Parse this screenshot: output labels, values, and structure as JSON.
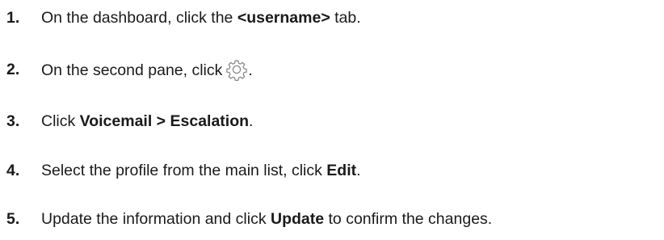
{
  "steps": [
    {
      "number": "1.",
      "before": "On the dashboard, click the ",
      "bold": "<username>",
      "after": " tab."
    },
    {
      "number": "2.",
      "before": "On the second pane, click",
      "icon": "gear-icon",
      "after": "."
    },
    {
      "number": "3.",
      "before": "Click ",
      "bold": "Voicemail > Escalation",
      "after": "."
    },
    {
      "number": "4.",
      "before": "Select the profile from the main list, click ",
      "bold": "Edit",
      "after": "."
    },
    {
      "number": "5.",
      "before": "Update the information and click ",
      "bold": "Update",
      "after": " to confirm the changes."
    }
  ],
  "colors": {
    "text": "#1a1a1a",
    "icon": "#8a8a8a"
  }
}
